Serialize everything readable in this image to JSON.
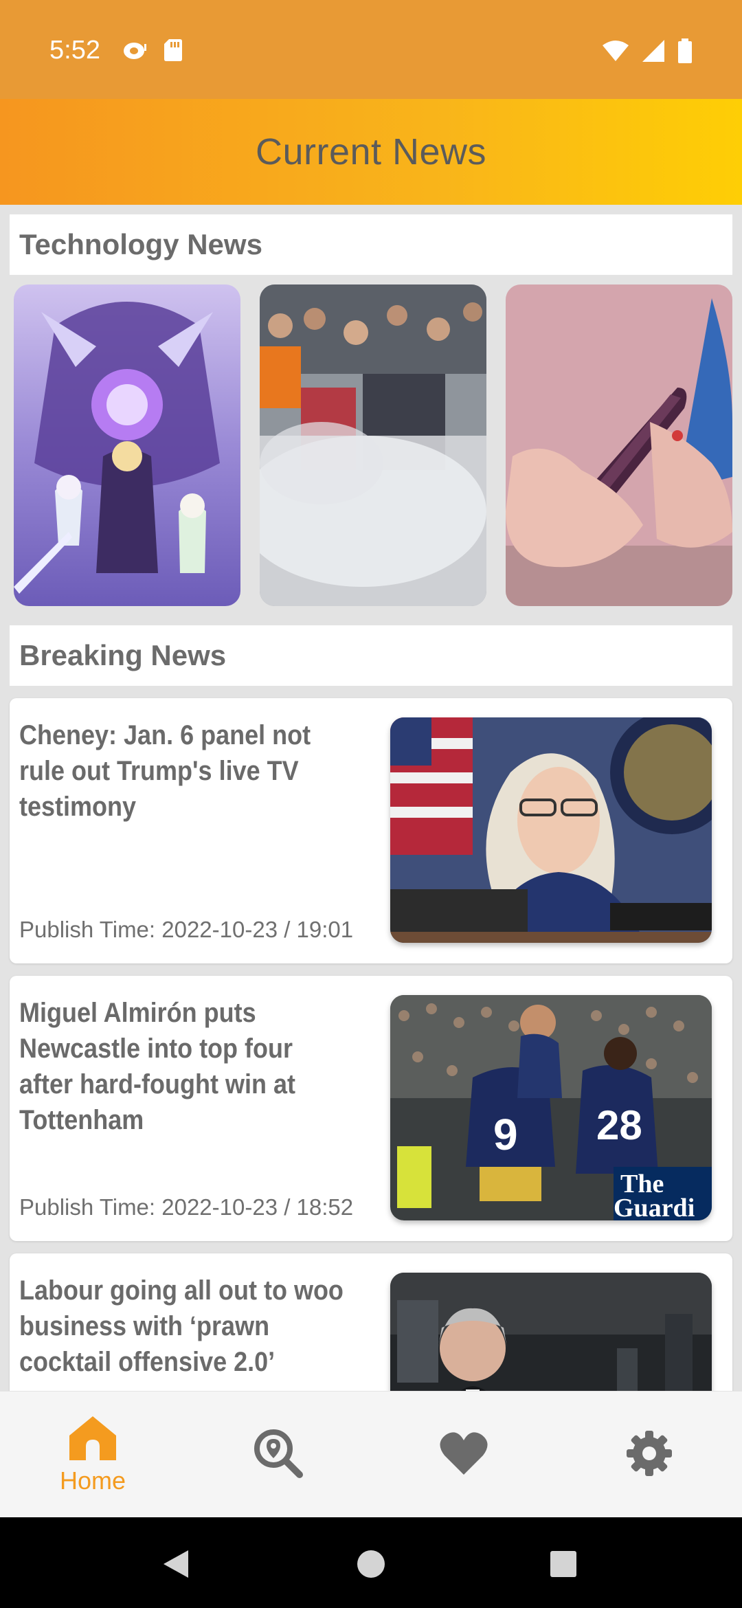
{
  "status_bar": {
    "time": "5:52",
    "icons": [
      "ring-icon",
      "sd-card-icon",
      "wifi-icon",
      "cellular-signal-icon",
      "battery-icon"
    ]
  },
  "app_bar": {
    "title": "Current News"
  },
  "sections": {
    "technology": {
      "title": "Technology News"
    },
    "breaking": {
      "title": "Breaking News"
    }
  },
  "technology_cards": [
    {
      "image": "anime-game-art-image"
    },
    {
      "image": "crowd-smoke-image"
    },
    {
      "image": "hands-holding-phone-image"
    }
  ],
  "news": [
    {
      "headline": "Cheney: Jan. 6 panel not rule out Trump's live TV testimony",
      "publish_time": "Publish Time: 2022-10-23 / 19:01",
      "image": "woman-at-hearing-image"
    },
    {
      "headline": "Miguel Almirón puts Newcastle into top four after hard-fought win at Tottenham",
      "publish_time": "Publish Time: 2022-10-23 / 18:52",
      "image": "football-celebration-image",
      "image_text": [
        "The",
        "Guardi"
      ],
      "jersey_numbers": [
        "9",
        "28"
      ]
    },
    {
      "headline": "Labour going all out to woo business with ‘prawn cocktail offensive 2.0’",
      "image": "man-in-suit-image"
    }
  ],
  "bottom_nav": {
    "items": [
      {
        "label": "Home",
        "icon": "home-icon",
        "active": true
      },
      {
        "icon": "location-search-icon"
      },
      {
        "icon": "heart-icon"
      },
      {
        "icon": "gear-icon"
      }
    ]
  },
  "colors": {
    "accent": "#f49b1f",
    "status_bar": "#e89a35",
    "gradient_start": "#f6961f",
    "gradient_end": "#fece05",
    "inactive_icon": "#6b6b6b"
  }
}
